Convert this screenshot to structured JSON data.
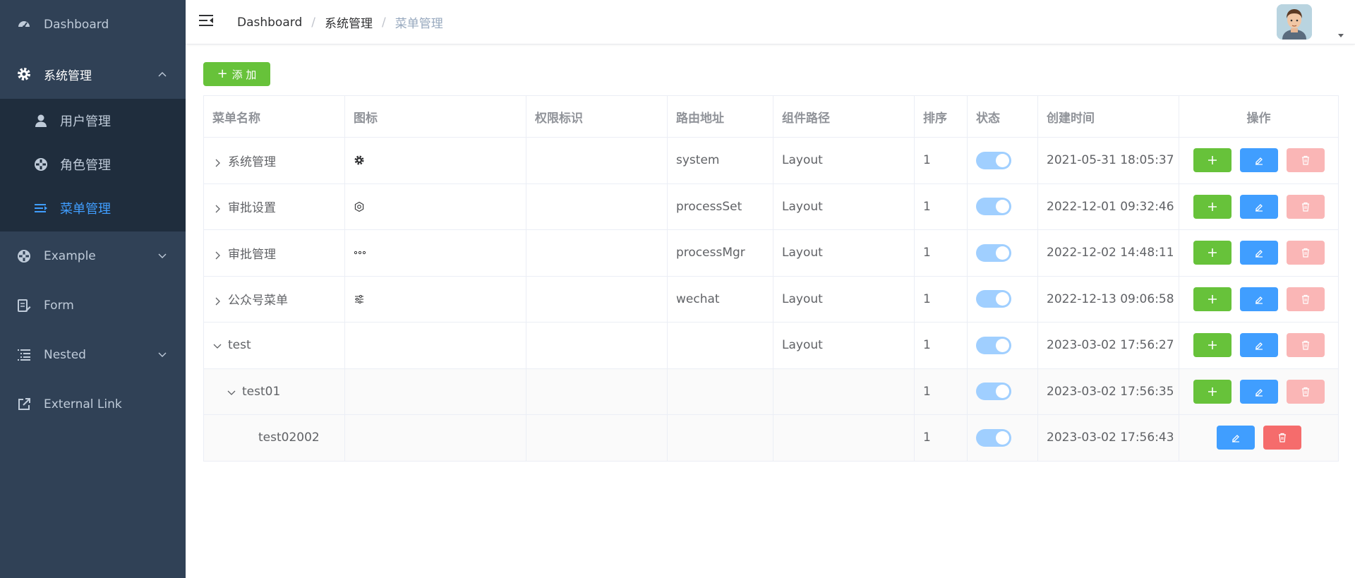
{
  "sidebar": {
    "items": [
      {
        "label": "Dashboard",
        "icon": "dashboard-icon"
      },
      {
        "label": "系统管理",
        "icon": "gear-icon"
      },
      {
        "label": "Example",
        "icon": "example-icon"
      },
      {
        "label": "Form",
        "icon": "form-icon"
      },
      {
        "label": "Nested",
        "icon": "nested-icon"
      },
      {
        "label": "External Link",
        "icon": "external-link-icon"
      }
    ],
    "submenu": [
      {
        "label": "用户管理",
        "icon": "user-icon"
      },
      {
        "label": "角色管理",
        "icon": "role-icon"
      },
      {
        "label": "菜单管理",
        "icon": "menu-list-icon"
      }
    ],
    "active_color": "#409eff",
    "bg_color": "#304156"
  },
  "header": {
    "breadcrumb": [
      "Dashboard",
      "系统管理",
      "菜单管理"
    ]
  },
  "toolbar": {
    "add_label": "添 加"
  },
  "table": {
    "columns": [
      "菜单名称",
      "图标",
      "权限标识",
      "路由地址",
      "组件路径",
      "排序",
      "状态",
      "创建时间",
      "操作"
    ],
    "rows": [
      {
        "name": "系统管理",
        "icon": "gear-icon",
        "perm": "",
        "path": "system",
        "component": "Layout",
        "sort": "1",
        "status": true,
        "created": "2021-05-31 18:05:37"
      },
      {
        "name": "审批设置",
        "icon": "setting-icon",
        "perm": "",
        "path": "processSet",
        "component": "Layout",
        "sort": "1",
        "status": true,
        "created": "2022-12-01 09:32:46"
      },
      {
        "name": "审批管理",
        "icon": "more-icon",
        "perm": "",
        "path": "processMgr",
        "component": "Layout",
        "sort": "1",
        "status": true,
        "created": "2022-12-02 14:48:11"
      },
      {
        "name": "公众号菜单",
        "icon": "sliders-icon",
        "perm": "",
        "path": "wechat",
        "component": "Layout",
        "sort": "1",
        "status": true,
        "created": "2022-12-13 09:06:58"
      },
      {
        "name": "test",
        "icon": "",
        "perm": "",
        "path": "",
        "component": "Layout",
        "sort": "1",
        "status": true,
        "created": "2023-03-02 17:56:27"
      },
      {
        "name": "test01",
        "icon": "",
        "perm": "",
        "path": "",
        "component": "",
        "sort": "1",
        "status": true,
        "created": "2023-03-02 17:56:35"
      },
      {
        "name": "test02002",
        "icon": "",
        "perm": "",
        "path": "",
        "component": "",
        "sort": "1",
        "status": true,
        "created": "2023-03-02 17:56:43"
      }
    ]
  }
}
